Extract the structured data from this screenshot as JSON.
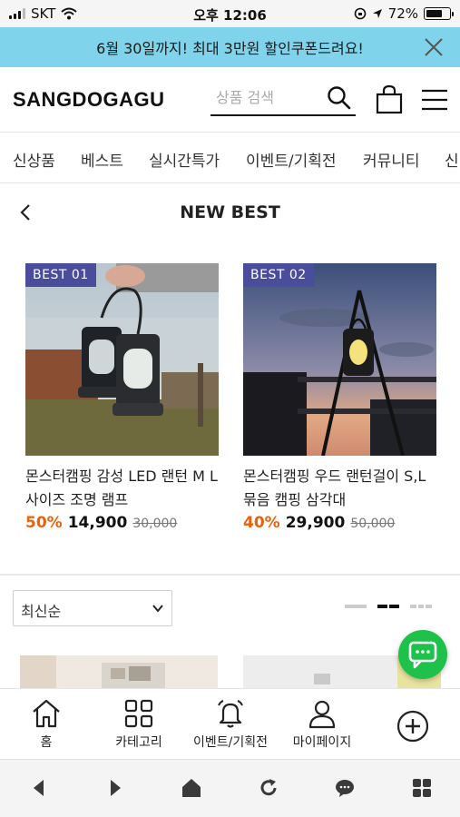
{
  "status_bar": {
    "carrier": "SKT",
    "time": "오후 12:06",
    "battery": "72%",
    "battery_level": 0.72
  },
  "promo": {
    "text": "6월 30일까지! 최대 3만원 할인쿠폰드려요!"
  },
  "header": {
    "logo": "SANGDOGAGU",
    "search_placeholder": "상품 검색"
  },
  "category_nav": {
    "items": [
      "신상품",
      "베스트",
      "실시간특가",
      "이벤트/기획전",
      "커뮤니티",
      "신"
    ]
  },
  "page": {
    "title": "NEW BEST"
  },
  "products": [
    {
      "badge": "BEST  01",
      "name": "몬스터캠핑 감성 LED 랜턴 M L 사이즈 조명 램프",
      "discount": "50%",
      "price": "14,900",
      "original_price": "30,000"
    },
    {
      "badge": "BEST  02",
      "name": "몬스터캠핑 우드 랜턴걸이 S,L 묶음 캠핑 삼각대",
      "discount": "40%",
      "price": "29,900",
      "original_price": "50,000"
    }
  ],
  "sort": {
    "selected": "최신순"
  },
  "bottom_nav": {
    "items": [
      "홈",
      "카테고리",
      "이벤트/기획전",
      "마이페이지"
    ]
  },
  "colors": {
    "promo_bg": "#7fd3ea",
    "badge_bg": "#4a4d9c",
    "discount": "#e8620d",
    "chat_fab": "#1ec24a"
  },
  "icons": [
    "wifi-icon",
    "close-icon",
    "search-icon",
    "shopping-bag-icon",
    "menu-icon",
    "back-icon",
    "chevron-down-icon",
    "chat-icon",
    "home-icon",
    "grid-icon",
    "bell-icon",
    "user-icon",
    "plus-circle-icon"
  ]
}
